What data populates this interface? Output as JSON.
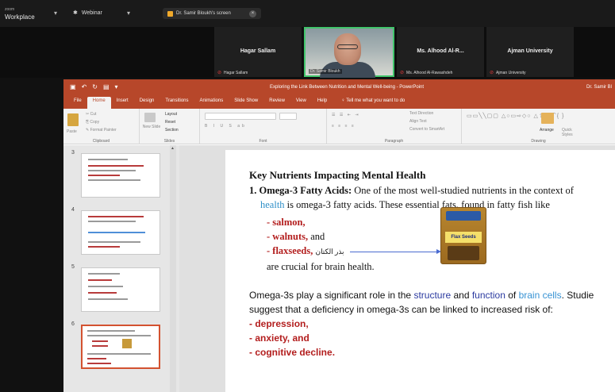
{
  "zoom": {
    "brand_line1": "zoom",
    "brand_line2": "Workplace",
    "meeting_label": "Webinar",
    "share_label": "Dr. Samir Bloukh's screen",
    "participants": [
      {
        "name": "Hagar Sallam",
        "tag": "Hagar Sallam"
      },
      {
        "name": "",
        "tag": "Dr. Samir Bloukh"
      },
      {
        "name": "Ms. Alhood Al-R...",
        "tag": "Ms. Alhood Al-Rawashdeh"
      },
      {
        "name": "Ajman University",
        "tag": "Ajman University"
      }
    ]
  },
  "powerpoint": {
    "doc_title": "Exploring the Link Between Nutrition and Mental Well-being  -  PowerPoint",
    "user": "Dr. Samir Bl",
    "tabs": [
      "File",
      "Home",
      "Insert",
      "Design",
      "Transitions",
      "Animations",
      "Slide Show",
      "Review",
      "View",
      "Help",
      "Tell me what you want to do"
    ],
    "active_tab": "Home",
    "ribbon_groups": [
      "Clipboard",
      "Slides",
      "Font",
      "Paragraph",
      "Drawing"
    ],
    "ribbon_buttons": {
      "paste": "Paste",
      "cut": "Cut",
      "copy": "Copy",
      "format_painter": "Format Painter",
      "new_slide": "New Slide",
      "layout": "Layout",
      "reset": "Reset",
      "section": "Section",
      "text_direction": "Text Direction",
      "align_text": "Align Text",
      "convert_smartart": "Convert to SmartArt",
      "arrange": "Arrange",
      "quick_styles": "Quick Styles"
    },
    "slide_numbers": [
      "3",
      "4",
      "5",
      "6"
    ],
    "selected_slide": "6"
  },
  "slide": {
    "title": "Key Nutrients Impacting Mental Health",
    "item_number": "1.",
    "item_heading": "Omega-3 Fatty Acids:",
    "item_text_1": " One of the most well-studied nutrients in the context of",
    "item_link": "health",
    "item_text_2": " is omega-3 fatty acids. These essential fats, found in fatty fish like",
    "bullets": [
      "- salmon,",
      "- walnuts,",
      "- flaxseeds,"
    ],
    "walnuts_suffix": " and",
    "arabic_label": "بذر الكتان",
    "bag_label": "Flax Seeds",
    "crucial": "are crucial for brain health.",
    "para_1a": "Omega-3s play a significant role in the ",
    "para_kw1": "structure",
    "para_and": " and ",
    "para_kw2": "function",
    "para_of": " of ",
    "para_kw3": "brain cells",
    "para_1b": ". Studie",
    "para_2": "suggest that a deficiency in omega-3s can be linked to increased risk of:",
    "risks": [
      "- depression,",
      "- anxiety, and",
      "- cognitive decline."
    ]
  }
}
